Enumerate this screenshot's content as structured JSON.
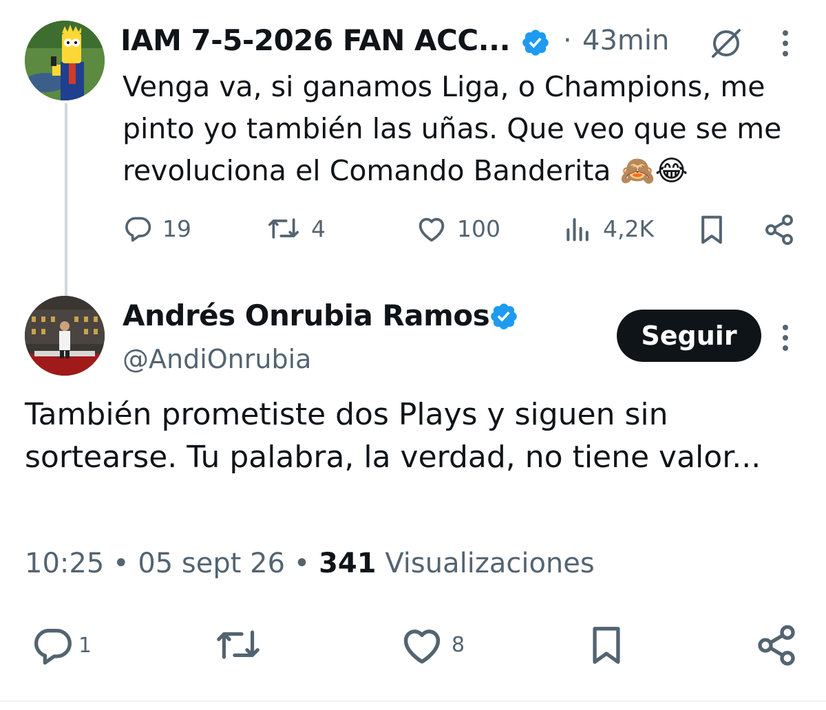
{
  "parent_tweet": {
    "display_name": "IAM 7-5-2026 FAN ACC...",
    "separator": "·",
    "time_ago": "43min",
    "text": "Venga va, si ganamos Liga, o Champions, me pinto yo también las uñas. Que veo que se me revoluciona el Comando Banderita 🙈😂",
    "actions": {
      "replies": "19",
      "retweets": "4",
      "likes": "100",
      "views": "4,2K"
    }
  },
  "reply_tweet": {
    "display_name": "Andrés Onrubia Ramos",
    "handle": "@AndiOnrubia",
    "follow_label": "Seguir",
    "text": "También prometiste dos Plays y siguen sin sortearse. Tu palabra, la verdad, no tiene valor...",
    "time": "10:25",
    "date": "05 sept 26",
    "views_count": "341",
    "views_label": "Visualizaciones",
    "meta_separator": "•",
    "actions": {
      "replies": "1",
      "likes": "8"
    }
  },
  "colors": {
    "text_primary": "#0f1419",
    "text_secondary": "#536471",
    "verified_blue": "#1d9bf0",
    "follow_button_bg": "#0f1419"
  },
  "icons": [
    "verified-badge-icon",
    "grok-icon",
    "more-vertical-icon",
    "reply-icon",
    "retweet-icon",
    "like-icon",
    "views-icon",
    "bookmark-icon",
    "share-icon"
  ]
}
